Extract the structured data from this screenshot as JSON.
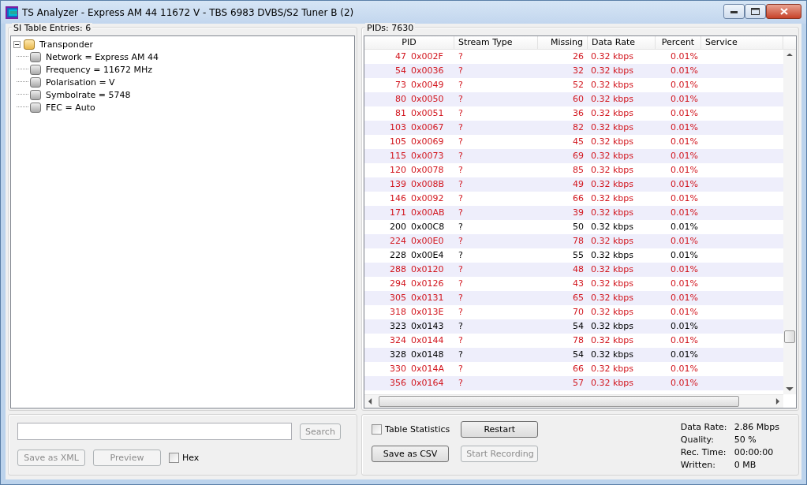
{
  "window": {
    "title": "TS Analyzer - Express AM 44 11672 V - TBS 6983 DVBS/S2 Tuner B (2)"
  },
  "si_panel": {
    "title": "SI Table Entries: 6",
    "tree": [
      {
        "label": "Transponder",
        "expanded": true,
        "children": [
          {
            "label": "Network = Express AM 44"
          },
          {
            "label": "Frequency = 11672 MHz"
          },
          {
            "label": "Polarisation = V"
          },
          {
            "label": "Symbolrate = 5748"
          },
          {
            "label": "FEC = Auto"
          }
        ]
      }
    ],
    "search": {
      "button": "Search",
      "button_disabled": true
    },
    "buttons": [
      {
        "label": "Save as XML",
        "disabled": true
      },
      {
        "label": "Preview",
        "disabled": true
      }
    ],
    "hex": {
      "label": "Hex",
      "checked": false
    }
  },
  "pid_panel": {
    "title": "PIDs: 7630",
    "columns": [
      "PID",
      "Stream Type",
      "Missing",
      "Data Rate",
      "Percent",
      "Service"
    ],
    "rows": [
      {
        "pid": "47",
        "hex": "0x002F",
        "type": "?",
        "missing": "26",
        "rate": "0.32 kbps",
        "percent": "0.01%",
        "error": true
      },
      {
        "pid": "54",
        "hex": "0x0036",
        "type": "?",
        "missing": "32",
        "rate": "0.32 kbps",
        "percent": "0.01%",
        "error": true
      },
      {
        "pid": "73",
        "hex": "0x0049",
        "type": "?",
        "missing": "52",
        "rate": "0.32 kbps",
        "percent": "0.01%",
        "error": true
      },
      {
        "pid": "80",
        "hex": "0x0050",
        "type": "?",
        "missing": "60",
        "rate": "0.32 kbps",
        "percent": "0.01%",
        "error": true
      },
      {
        "pid": "81",
        "hex": "0x0051",
        "type": "?",
        "missing": "36",
        "rate": "0.32 kbps",
        "percent": "0.01%",
        "error": true
      },
      {
        "pid": "103",
        "hex": "0x0067",
        "type": "?",
        "missing": "82",
        "rate": "0.32 kbps",
        "percent": "0.01%",
        "error": true
      },
      {
        "pid": "105",
        "hex": "0x0069",
        "type": "?",
        "missing": "45",
        "rate": "0.32 kbps",
        "percent": "0.01%",
        "error": true
      },
      {
        "pid": "115",
        "hex": "0x0073",
        "type": "?",
        "missing": "69",
        "rate": "0.32 kbps",
        "percent": "0.01%",
        "error": true
      },
      {
        "pid": "120",
        "hex": "0x0078",
        "type": "?",
        "missing": "85",
        "rate": "0.32 kbps",
        "percent": "0.01%",
        "error": true
      },
      {
        "pid": "139",
        "hex": "0x008B",
        "type": "?",
        "missing": "49",
        "rate": "0.32 kbps",
        "percent": "0.01%",
        "error": true
      },
      {
        "pid": "146",
        "hex": "0x0092",
        "type": "?",
        "missing": "66",
        "rate": "0.32 kbps",
        "percent": "0.01%",
        "error": true
      },
      {
        "pid": "171",
        "hex": "0x00AB",
        "type": "?",
        "missing": "39",
        "rate": "0.32 kbps",
        "percent": "0.01%",
        "error": true
      },
      {
        "pid": "200",
        "hex": "0x00C8",
        "type": "?",
        "missing": "50",
        "rate": "0.32 kbps",
        "percent": "0.01%",
        "error": false
      },
      {
        "pid": "224",
        "hex": "0x00E0",
        "type": "?",
        "missing": "78",
        "rate": "0.32 kbps",
        "percent": "0.01%",
        "error": true
      },
      {
        "pid": "228",
        "hex": "0x00E4",
        "type": "?",
        "missing": "55",
        "rate": "0.32 kbps",
        "percent": "0.01%",
        "error": false
      },
      {
        "pid": "288",
        "hex": "0x0120",
        "type": "?",
        "missing": "48",
        "rate": "0.32 kbps",
        "percent": "0.01%",
        "error": true
      },
      {
        "pid": "294",
        "hex": "0x0126",
        "type": "?",
        "missing": "43",
        "rate": "0.32 kbps",
        "percent": "0.01%",
        "error": true
      },
      {
        "pid": "305",
        "hex": "0x0131",
        "type": "?",
        "missing": "65",
        "rate": "0.32 kbps",
        "percent": "0.01%",
        "error": true
      },
      {
        "pid": "318",
        "hex": "0x013E",
        "type": "?",
        "missing": "70",
        "rate": "0.32 kbps",
        "percent": "0.01%",
        "error": true
      },
      {
        "pid": "323",
        "hex": "0x0143",
        "type": "?",
        "missing": "54",
        "rate": "0.32 kbps",
        "percent": "0.01%",
        "error": false
      },
      {
        "pid": "324",
        "hex": "0x0144",
        "type": "?",
        "missing": "78",
        "rate": "0.32 kbps",
        "percent": "0.01%",
        "error": true
      },
      {
        "pid": "328",
        "hex": "0x0148",
        "type": "?",
        "missing": "54",
        "rate": "0.32 kbps",
        "percent": "0.01%",
        "error": false
      },
      {
        "pid": "330",
        "hex": "0x014A",
        "type": "?",
        "missing": "66",
        "rate": "0.32 kbps",
        "percent": "0.01%",
        "error": true
      },
      {
        "pid": "356",
        "hex": "0x0164",
        "type": "?",
        "missing": "57",
        "rate": "0.32 kbps",
        "percent": "0.01%",
        "error": true
      }
    ],
    "table_statistics": {
      "label": "Table Statistics",
      "checked": false
    },
    "buttons": [
      {
        "label": "Restart",
        "disabled": false
      },
      {
        "label": "Save as CSV",
        "disabled": false
      },
      {
        "label": "Start Recording",
        "disabled": true
      }
    ],
    "stats": [
      {
        "label": "Data Rate:",
        "value": "2.86 Mbps"
      },
      {
        "label": "Quality:",
        "value": "50 %"
      },
      {
        "label": "Rec. Time:",
        "value": "00:00:00"
      },
      {
        "label": "Written:",
        "value": "0 MB"
      }
    ]
  }
}
